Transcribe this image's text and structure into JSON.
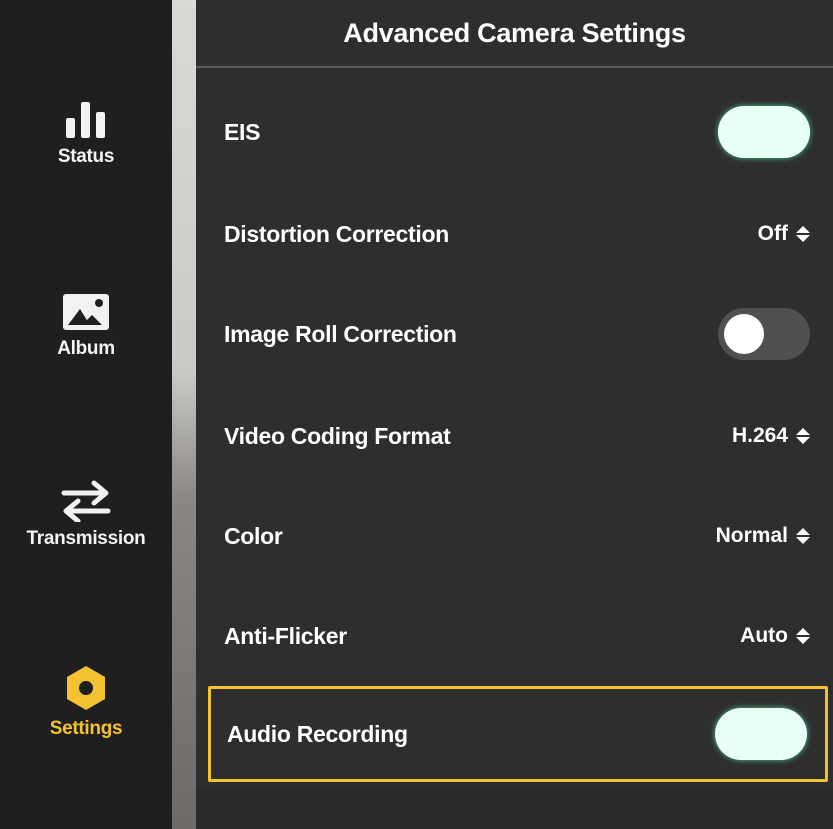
{
  "sidebar": {
    "items": [
      {
        "label": "Status",
        "icon": "bar-chart-icon",
        "active": false
      },
      {
        "label": "Album",
        "icon": "image-icon",
        "active": false
      },
      {
        "label": "Transmission",
        "icon": "swap-arrows-icon",
        "active": false
      },
      {
        "label": "Settings",
        "icon": "hexagon-settings-icon",
        "active": true
      }
    ]
  },
  "panel": {
    "title": "Advanced Camera Settings",
    "rows": [
      {
        "label": "EIS",
        "type": "toggle",
        "state": "on"
      },
      {
        "label": "Distortion Correction",
        "type": "select",
        "value": "Off"
      },
      {
        "label": "Image Roll Correction",
        "type": "toggle",
        "state": "off"
      },
      {
        "label": "Video Coding Format",
        "type": "select",
        "value": "H.264"
      },
      {
        "label": "Color",
        "type": "select",
        "value": "Normal"
      },
      {
        "label": "Anti-Flicker",
        "type": "select",
        "value": "Auto"
      },
      {
        "label": "Audio Recording",
        "type": "toggle",
        "state": "on",
        "highlighted": true
      }
    ]
  },
  "colors": {
    "accent": "#f2c230",
    "toggle_on": "#e8fff6",
    "toggle_off": "#505050",
    "background": "#2e2e2e"
  }
}
